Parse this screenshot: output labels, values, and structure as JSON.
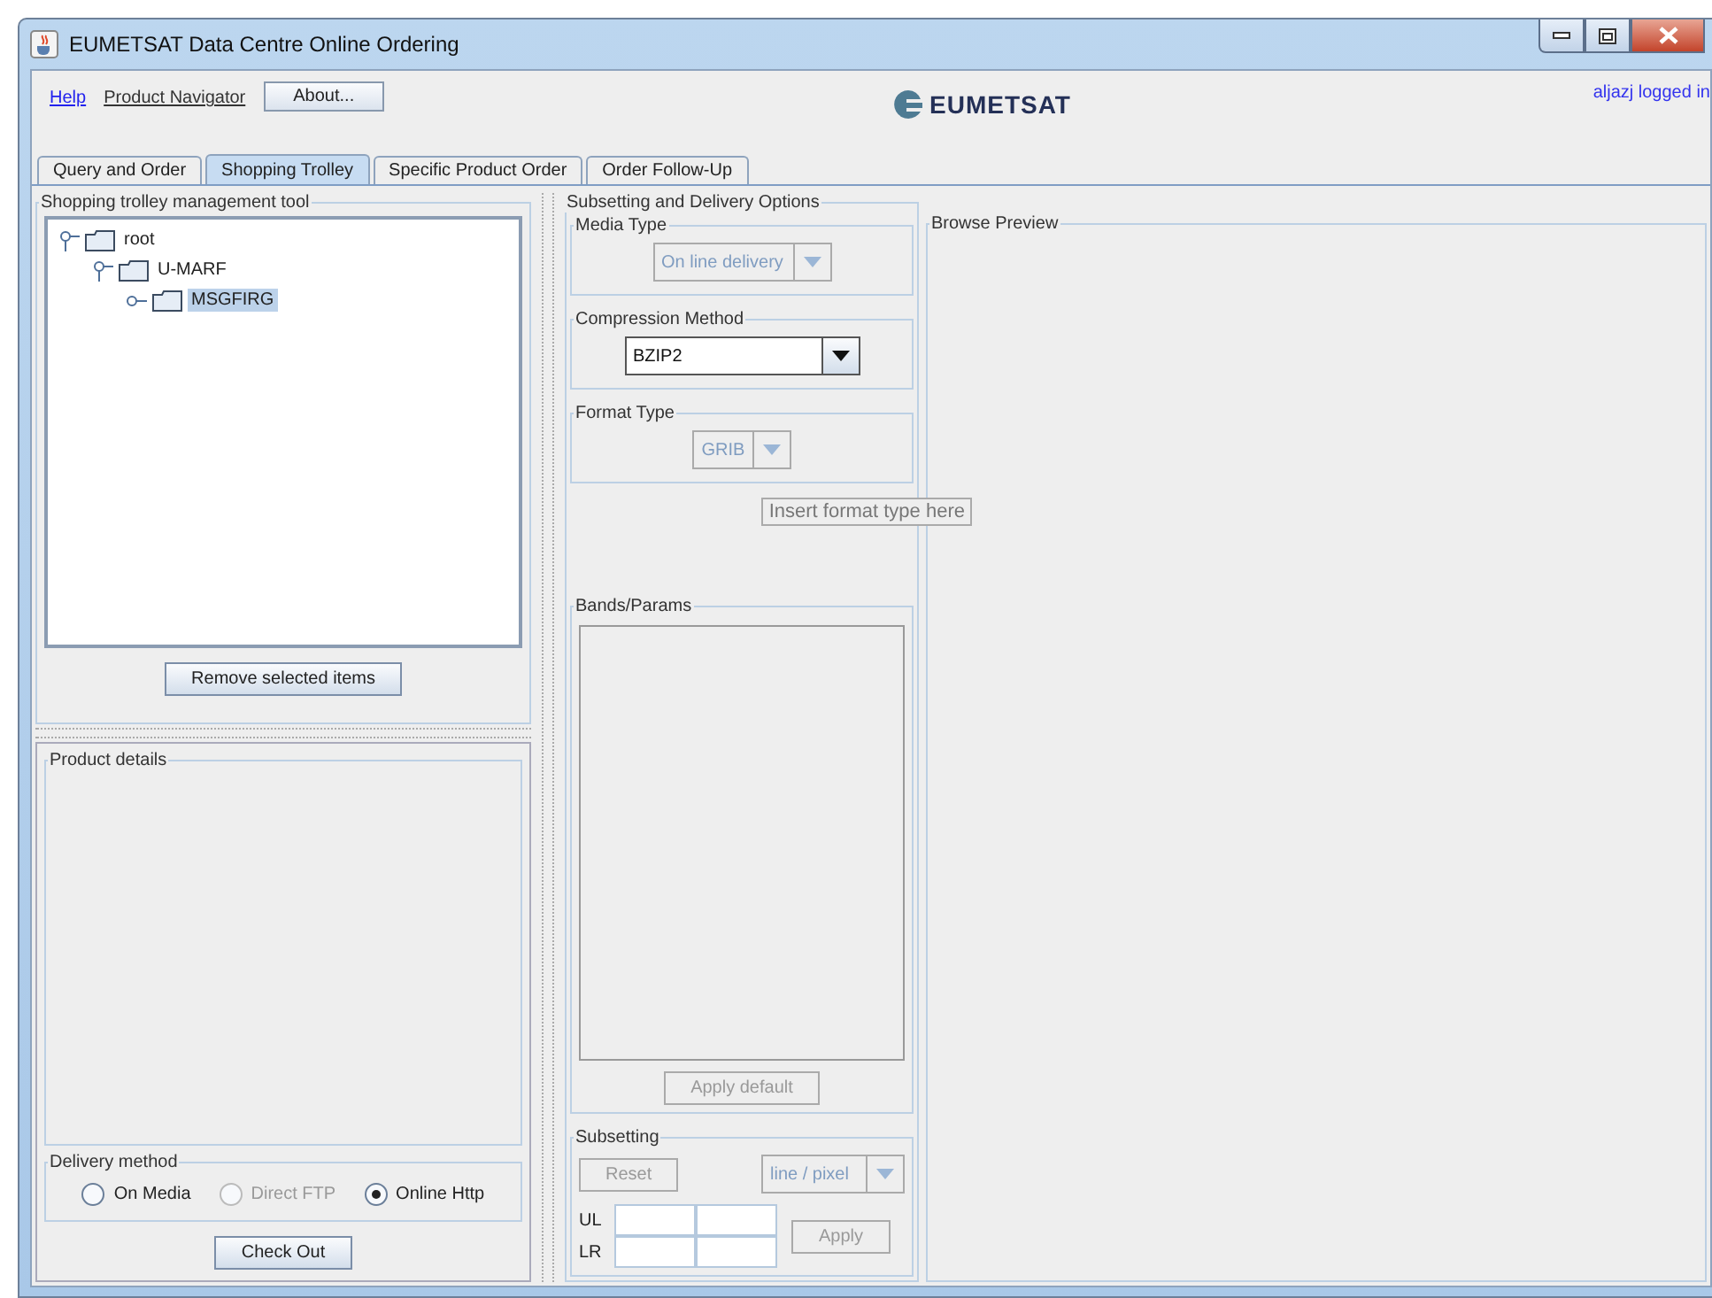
{
  "window": {
    "title": "EUMETSAT Data Centre Online Ordering"
  },
  "header": {
    "links": [
      {
        "label": "Help",
        "kind": "link"
      },
      {
        "label": "Product Navigator",
        "kind": "link"
      },
      {
        "label": "About...",
        "kind": "button"
      }
    ],
    "logo": "EUMETSAT",
    "user_status": "aljazj logged in"
  },
  "tabs": [
    {
      "label": "Query and Order",
      "selected": false
    },
    {
      "label": "Shopping Trolley",
      "selected": true
    },
    {
      "label": "Specific Product Order",
      "selected": false
    },
    {
      "label": "Order Follow-Up",
      "selected": false
    }
  ],
  "trolley": {
    "title": "Shopping trolley management tool",
    "tree": [
      {
        "label": "root",
        "expanded": true,
        "selected": false,
        "children": [
          {
            "label": "U-MARF",
            "expanded": true,
            "selected": false,
            "children": [
              {
                "label": "MSGFIRG",
                "expanded": false,
                "selected": true
              }
            ]
          }
        ]
      }
    ],
    "remove_button": "Remove selected items"
  },
  "product_details": {
    "title": "Product details"
  },
  "delivery": {
    "title": "Delivery method",
    "options": [
      {
        "label": "On Media",
        "selected": false,
        "disabled": false
      },
      {
        "label": "Direct FTP",
        "selected": false,
        "disabled": true
      },
      {
        "label": "Online Http",
        "selected": true,
        "disabled": false
      }
    ]
  },
  "checkout_button": "Check Out",
  "options": {
    "title": "Subsetting and Delivery Options",
    "media_type": {
      "title": "Media Type",
      "value": "On line delivery",
      "disabled": true
    },
    "compression": {
      "title": "Compression Method",
      "value": "BZIP2",
      "disabled": false
    },
    "format": {
      "title": "Format Type",
      "value": "GRIB",
      "disabled": true
    },
    "tooltip": "Insert format type here",
    "bands": {
      "title": "Bands/Params",
      "button": {
        "label": "Apply default",
        "disabled": true
      }
    },
    "subsetting": {
      "title": "Subsetting",
      "reset": {
        "label": "Reset",
        "disabled": true
      },
      "unit": {
        "value": "line / pixel",
        "disabled": true
      },
      "rows": [
        {
          "label": "UL"
        },
        {
          "label": "LR"
        }
      ],
      "apply": {
        "label": "Apply",
        "disabled": true
      }
    }
  },
  "browse_preview": {
    "title": "Browse Preview"
  }
}
